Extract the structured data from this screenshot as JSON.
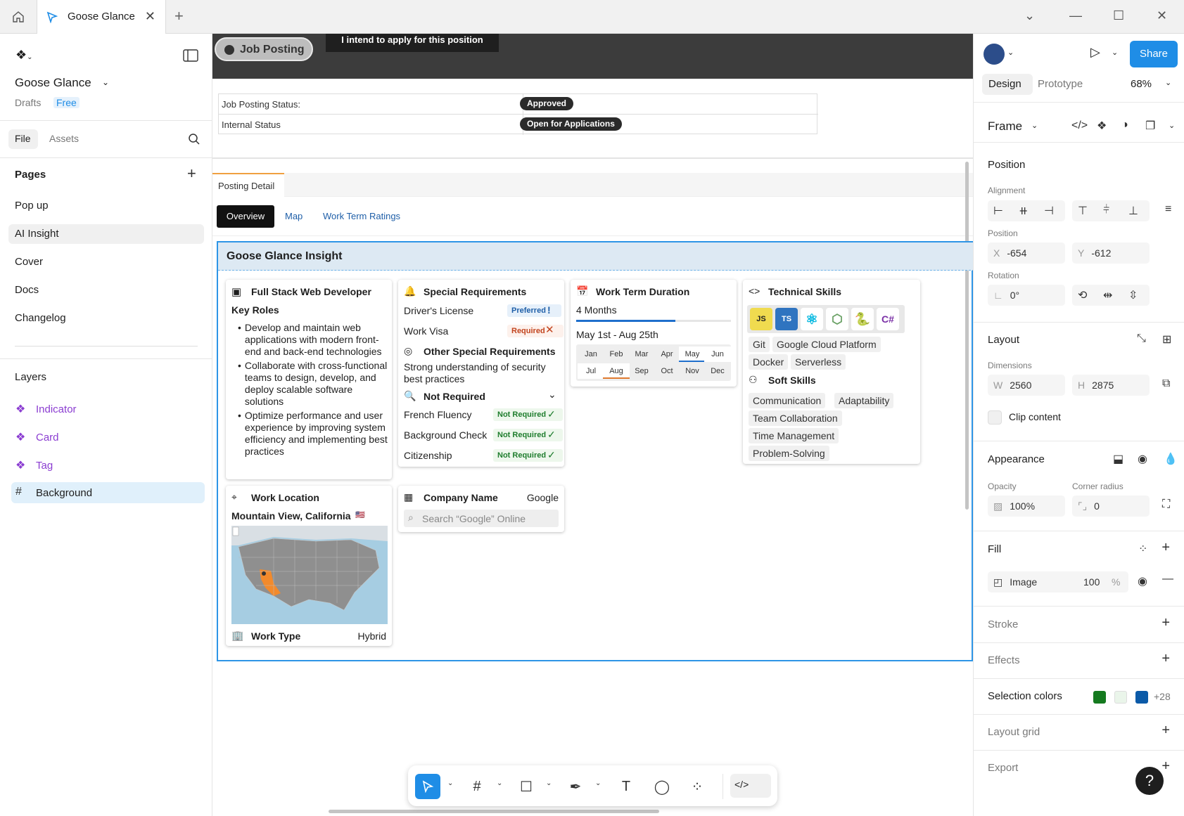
{
  "tab": {
    "title": "Goose Glance"
  },
  "left": {
    "file_name": "Goose Glance",
    "drafts": "Drafts",
    "plan": "Free",
    "tabs": [
      "File",
      "Assets"
    ],
    "pages_title": "Pages",
    "pages": [
      "Pop up",
      "AI Insight",
      "Cover",
      "Docs",
      "Changelog"
    ],
    "layers_title": "Layers",
    "layers": [
      {
        "label": "Indicator",
        "kind": "component"
      },
      {
        "label": "Card",
        "kind": "component"
      },
      {
        "label": "Tag",
        "kind": "component"
      },
      {
        "label": "Background",
        "kind": "frame"
      }
    ]
  },
  "canvas": {
    "job_pill": "Job Posting",
    "intend": "I intend to apply for this position",
    "status_rows": [
      {
        "key": "Job Posting Status:",
        "value": "Approved"
      },
      {
        "key": "Internal Status",
        "value": "Open for Applications"
      }
    ],
    "posting_tab": "Posting Detail",
    "subtabs": [
      "Overview",
      "Map",
      "Work Term Ratings"
    ],
    "insight_title": "Goose Glance Insight",
    "role": {
      "title": "Full Stack Web Developer",
      "key_roles": "Key Roles",
      "bullets": [
        "Develop and maintain web applications with modern front-end and back-end technologies",
        "Collaborate with cross-functional teams to design, develop, and deploy scalable software solutions",
        "Optimize performance and user experience by improving system efficiency and implementing best practices"
      ]
    },
    "special": {
      "title": "Special Requirements",
      "items": [
        {
          "label": "Driver's License",
          "tag": "Preferred",
          "mark": "!"
        },
        {
          "label": "Work Visa",
          "tag": "Required",
          "mark": "✕"
        }
      ],
      "other_title": "Other Special Requirements",
      "other_text": "Strong understanding of security best practices",
      "not_required_title": "Not Required",
      "not_required": [
        {
          "label": "French Fluency",
          "tag": "Not Required"
        },
        {
          "label": "Background Check",
          "tag": "Not Required"
        },
        {
          "label": "Citizenship",
          "tag": "Not Required"
        }
      ]
    },
    "term": {
      "title": "Work Term Duration",
      "length": "4 Months",
      "progress": 0.64,
      "range": "May 1st - Aug 25th",
      "months_row1": [
        "Jan",
        "Feb",
        "Mar",
        "Apr",
        "May",
        "Jun"
      ],
      "months_row2": [
        "Jul",
        "Aug",
        "Sep",
        "Oct",
        "Nov",
        "Dec"
      ]
    },
    "tech": {
      "title": "Technical Skills",
      "logos": [
        "JS",
        "TS",
        "React",
        "Node.js",
        "Python",
        "C#"
      ],
      "skills": [
        "Git",
        "Google Cloud Platform",
        "Docker",
        "Serverless"
      ],
      "soft_title": "Soft Skills",
      "soft": [
        "Communication",
        "Adaptability",
        "Team Collaboration",
        "Time Management",
        "Problem-Solving"
      ]
    },
    "location": {
      "title": "Work Location",
      "value": "Mountain View, California",
      "flag": "🇺🇸",
      "work_type_label": "Work Type",
      "work_type": "Hybrid"
    },
    "company": {
      "title": "Company Name",
      "value": "Google",
      "search_placeholder": "Search “Google” Online"
    }
  },
  "right": {
    "share": "Share",
    "tabs": [
      "Design",
      "Prototype"
    ],
    "zoom": "68%",
    "frame": "Frame",
    "position_title": "Position",
    "alignment": "Alignment",
    "position_label": "Position",
    "x": "-654",
    "y": "-612",
    "rotation_label": "Rotation",
    "rotation": "0°",
    "layout_title": "Layout",
    "dimensions": "Dimensions",
    "w": "2560",
    "h": "2875",
    "clip": "Clip content",
    "appearance": "Appearance",
    "opacity_label": "Opacity",
    "opacity": "100%",
    "radius_label": "Corner radius",
    "radius": "0",
    "fill": "Fill",
    "fill_type": "Image",
    "fill_value": "100",
    "fill_unit": "%",
    "stroke": "Stroke",
    "effects": "Effects",
    "selection_colors": "Selection colors",
    "sel_swatches": [
      "#157a1f",
      "#eaf5ea",
      "#0b5aa8"
    ],
    "sel_more": "+28",
    "layout_grid": "Layout grid",
    "export": "Export",
    "help": "?"
  }
}
